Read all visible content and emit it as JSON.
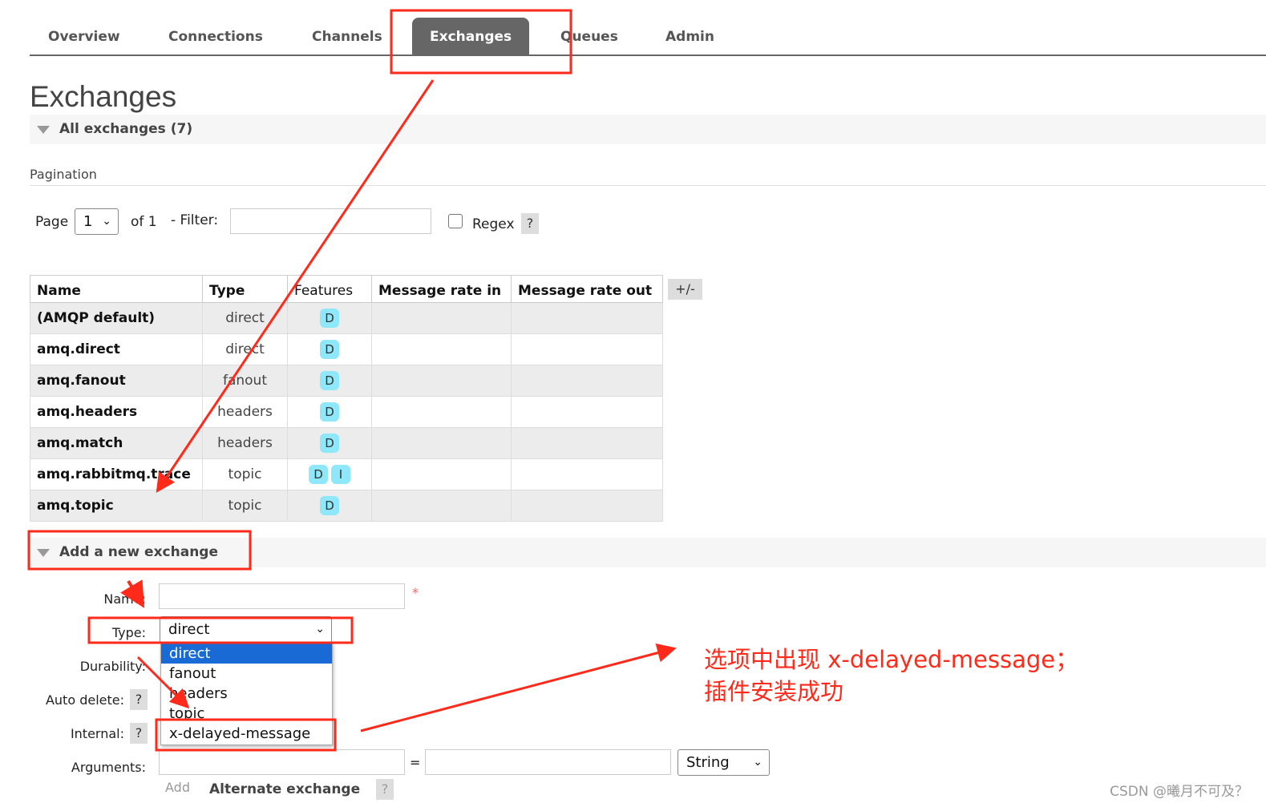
{
  "nav": {
    "tabs": [
      {
        "label": "Overview"
      },
      {
        "label": "Connections"
      },
      {
        "label": "Channels"
      },
      {
        "label": "Exchanges",
        "active": true
      },
      {
        "label": "Queues"
      },
      {
        "label": "Admin"
      }
    ]
  },
  "page_title": "Exchanges",
  "all_exchanges": {
    "label": "All exchanges (7)"
  },
  "pagination": {
    "label": "Pagination",
    "page_label": "Page",
    "page_value": "1",
    "of_label": "of 1",
    "filter_label": "- Filter:",
    "filter_value": "",
    "regex_label": "Regex",
    "help": "?"
  },
  "table": {
    "headers": [
      "Name",
      "Type",
      "Features",
      "Message rate in",
      "Message rate out"
    ],
    "toggle_label": "+/-",
    "rows": [
      {
        "name": "(AMQP default)",
        "type": "direct",
        "features": [
          "D"
        ]
      },
      {
        "name": "amq.direct",
        "type": "direct",
        "features": [
          "D"
        ]
      },
      {
        "name": "amq.fanout",
        "type": "fanout",
        "features": [
          "D"
        ]
      },
      {
        "name": "amq.headers",
        "type": "headers",
        "features": [
          "D"
        ]
      },
      {
        "name": "amq.match",
        "type": "headers",
        "features": [
          "D"
        ]
      },
      {
        "name": "amq.rabbitmq.trace",
        "type": "topic",
        "features": [
          "D",
          "I"
        ]
      },
      {
        "name": "amq.topic",
        "type": "topic",
        "features": [
          "D"
        ]
      }
    ]
  },
  "add_exchange": {
    "label": "Add a new exchange",
    "name_label": "Name:",
    "name_value": "",
    "required": "*",
    "type_label": "Type:",
    "type_value": "direct",
    "type_options": [
      "direct",
      "fanout",
      "headers",
      "topic",
      "x-delayed-message"
    ],
    "durability_label": "Durability:",
    "auto_delete_label": "Auto delete:",
    "internal_label": "Internal:",
    "arguments_label": "Arguments:",
    "equals": "=",
    "arg_type": "String",
    "add_label": "Add",
    "alternate_label": "Alternate exchange",
    "help": "?"
  },
  "annotation": {
    "line1": "选项中出现 x-delayed-message；",
    "line2": "插件安装成功",
    "color": "#ff2a1a"
  },
  "watermark": "CSDN @曦月不可及？"
}
